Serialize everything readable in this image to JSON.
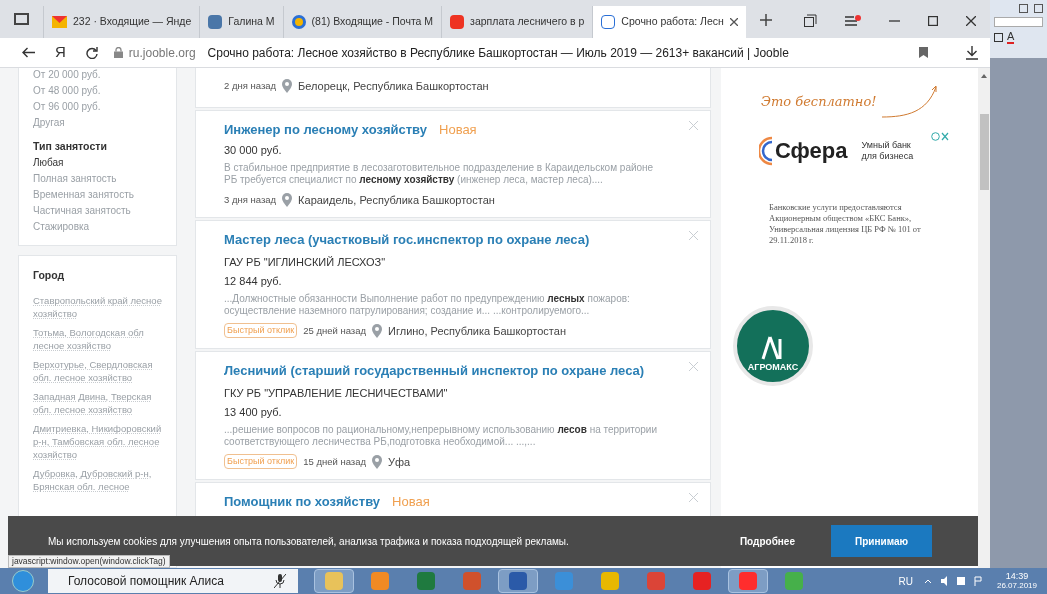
{
  "browser": {
    "tabs": [
      {
        "kind": "mail",
        "title": "232 · Входящие — Янде",
        "selected": false
      },
      {
        "kind": "vk",
        "title": "Галина М",
        "selected": false
      },
      {
        "kind": "at",
        "title": "(81) Входящие - Почта М",
        "selected": false
      },
      {
        "kind": "yandex",
        "title": "зарплата лесничего в р",
        "selected": false
      },
      {
        "kind": "jooble",
        "title": "Срочно работа: Лесн",
        "selected": true
      }
    ],
    "yandex_logo": "Я",
    "domain": "ru.jooble.org",
    "page_title": "Срочно работа: Лесное хозяйство в Республике Башкортостан — Июль 2019 — 2613+ вакансий | Jooble"
  },
  "sidebar": {
    "salary_options": [
      "От 20 000 руб.",
      "От 48 000 руб.",
      "От 96 000 руб.",
      "Другая"
    ],
    "employment": {
      "heading": "Тип занятости",
      "options": [
        {
          "label": "Любая",
          "selected": true
        },
        {
          "label": "Полная занятость",
          "selected": false
        },
        {
          "label": "Временная занятость",
          "selected": false
        },
        {
          "label": "Частичная занятость",
          "selected": false
        },
        {
          "label": "Стажировка",
          "selected": false
        }
      ]
    },
    "city": {
      "heading": "Город",
      "links": [
        "Ставропольский край лесное хозяйство",
        "Тотьма, Вологодская обл лесное хозяйство",
        "Верхотурье, Свердловская обл. лесное хозяйство",
        "Западная Двина, Тверская обл. лесное хозяйство",
        "Дмитриевка, Никифоровский р-н, Тамбовская обл. лесное хозяйство",
        "Дубровка, Дубровский р-н, Брянская обл. лесное"
      ]
    }
  },
  "jobs": [
    {
      "age": "2 дня назад",
      "location": "Белорецк, Республика Башкортостан"
    },
    {
      "title": "Инженер по лесному хозяйству",
      "badge": "Новая",
      "salary": "30 000 руб.",
      "description": "В стабильное предприятие в лесозаготовительное подразделение в Караидельском районе РБ требуется специалист по **лесному хозяйству** (инженер леса, мастер леса)....",
      "age": "3 дня назад",
      "location": "Караидель, Республика Башкортостан"
    },
    {
      "title": "Мастер леса (участковый гос.инспектор по охране леса)",
      "company": "ГАУ РБ \"ИГЛИНСКИЙ ЛЕСХОЗ\"",
      "salary": "12 844 руб.",
      "description": "...Должностные обязанности Выполнение работ по предупреждению **лесных** пожаров: осуществление наземного патрулирования; создание и...    ...контролируемого...",
      "quick_apply": "Быстрый отклик",
      "age": "25 дней назад",
      "location": "Иглино, Республика Башкортостан"
    },
    {
      "title": "Лесничий (старший государственный инспектор по охране леса)",
      "company": "ГКУ РБ \"УПРАВЛЕНИЕ ЛЕСНИЧЕСТВАМИ\"",
      "salary": "13 400 руб.",
      "description": "...решение вопросов по рациональному,непрерывному использованию **лесов** на территории соответствующего лесничества РБ,подготовка необходимой...    ...,...",
      "quick_apply": "Быстрый отклик",
      "age": "15 дней назад",
      "location": "Уфа"
    },
    {
      "title": "Помощник по хозяйству",
      "badge": "Новая"
    }
  ],
  "ads": {
    "free_note": "Это бесплатно!",
    "bank_logo": "Сфера",
    "bank_slogan": "Умный банк для бизнеса",
    "disclaimer": "Банковские услуги предоставляются Акционерным обществом «БКС Банк», Универсальная лицензия ЦБ РФ № 101 от 29.11.2018 г.",
    "agro_logo": "АГРОМАКС"
  },
  "cookie_bar": {
    "message": "Мы используем cookies для улучшения опыта пользователей, анализа трафика и показа подходящей рекламы.",
    "more": "Подробнее",
    "accept": "Принимаю"
  },
  "status_url": "javascript:window.open(window.clickTag)",
  "side_app": {
    "font_color_button": "A"
  },
  "taskbar": {
    "search_text": "Голосовой помощник Алиса",
    "apps": [
      {
        "kind": "folder",
        "selected": true
      },
      {
        "kind": "media",
        "selected": false
      },
      {
        "kind": "excel",
        "selected": false
      },
      {
        "kind": "powerpoint",
        "selected": false
      },
      {
        "kind": "word",
        "selected": true
      },
      {
        "kind": "mail",
        "selected": false
      },
      {
        "kind": "music",
        "selected": false
      },
      {
        "kind": "chrome",
        "selected": false
      },
      {
        "kind": "yandex",
        "selected": false
      },
      {
        "kind": "ybrowser",
        "selected": true
      },
      {
        "kind": "alice",
        "selected": false
      }
    ],
    "language": "RU",
    "time": "14:39",
    "date": "26.07.2019"
  }
}
